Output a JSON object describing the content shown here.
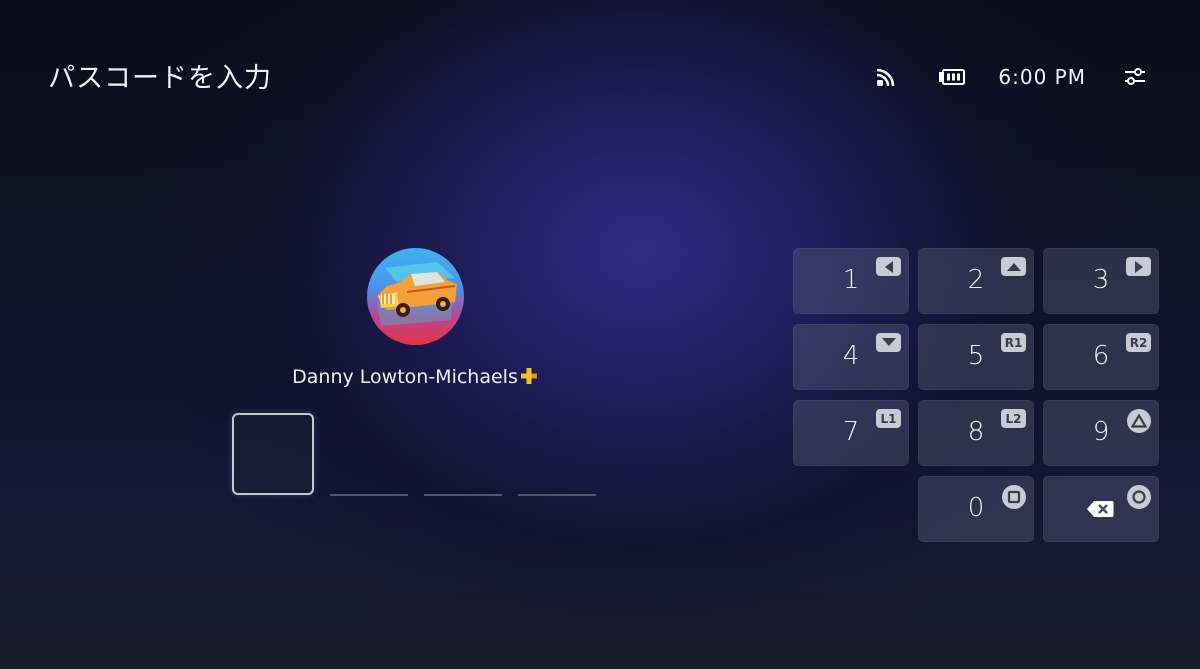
{
  "header": {
    "title": "パスコードを入力",
    "time": "6:00 PM"
  },
  "icons": {
    "network": "wifi-icon",
    "battery": "battery-icon",
    "settings": "settings-sliders-icon",
    "membership": "playstation-plus-icon",
    "backspace": "backspace-icon"
  },
  "profile": {
    "name": "Danny Lowton-Michaels"
  },
  "passcode": {
    "length": 4,
    "filled": 0
  },
  "keypad": {
    "keys": [
      {
        "digit": "1",
        "button": "dpad-left"
      },
      {
        "digit": "2",
        "button": "dpad-up"
      },
      {
        "digit": "3",
        "button": "dpad-right"
      },
      {
        "digit": "4",
        "button": "dpad-down"
      },
      {
        "digit": "5",
        "button": "R1"
      },
      {
        "digit": "6",
        "button": "R2"
      },
      {
        "digit": "7",
        "button": "L1"
      },
      {
        "digit": "8",
        "button": "L2"
      },
      {
        "digit": "9",
        "button": "triangle"
      },
      {
        "digit": "0",
        "button": "square"
      }
    ],
    "backspace_button": "circle"
  },
  "colors": {
    "accent_gold": "#f3c12e",
    "key_background": "#5a5c76",
    "badge": "#c9cad3"
  }
}
